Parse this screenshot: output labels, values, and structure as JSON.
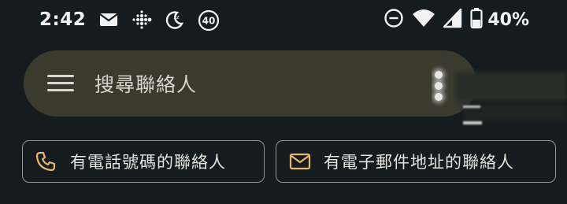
{
  "status_bar": {
    "time": "2:42",
    "notification_badge": "40",
    "battery_percent": "40%",
    "icons_left": [
      "mail-icon",
      "fitbit-icon",
      "do-not-disturb-moon-icon",
      "badge-40-icon"
    ],
    "icons_right": [
      "do-not-disturb-icon",
      "wifi-icon",
      "cell-signal-icon",
      "battery-icon"
    ]
  },
  "search": {
    "placeholder": "搜尋聯絡人",
    "menu_icon": "hamburger-menu-icon"
  },
  "chips": [
    {
      "label": "有電話號碼的聯絡人",
      "icon": "phone-icon"
    },
    {
      "label": "有電子郵件地址的聯絡人",
      "icon": "email-icon"
    }
  ],
  "colors": {
    "background": "#151c1f",
    "search_bar": "#3a3a2f",
    "chip_icon_accent": "#e9b66b",
    "chip_border": "#8d9396"
  }
}
